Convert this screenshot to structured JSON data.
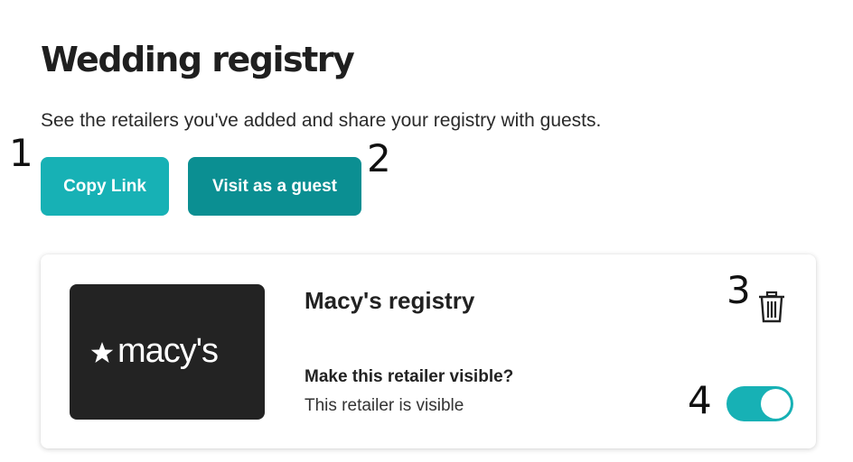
{
  "header": {
    "title": "Wedding registry",
    "subtitle": "See the retailers you've added and share your registry with guests."
  },
  "actions": {
    "copy_link_label": "Copy Link",
    "visit_guest_label": "Visit as a guest"
  },
  "markers": [
    "1",
    "2",
    "3",
    "4"
  ],
  "retailer": {
    "logo_text": "macy's",
    "name": "Macy's registry",
    "visibility_question": "Make this retailer visible?",
    "visibility_status": "This retailer is visible",
    "visible": true,
    "icons": {
      "delete": "trash-icon",
      "logo": "macys-star-logo"
    }
  },
  "colors": {
    "copy_button": "#17b1b5",
    "visit_button": "#0b8f92",
    "toggle_on": "#17b1b5",
    "logo_bg": "#232323"
  }
}
